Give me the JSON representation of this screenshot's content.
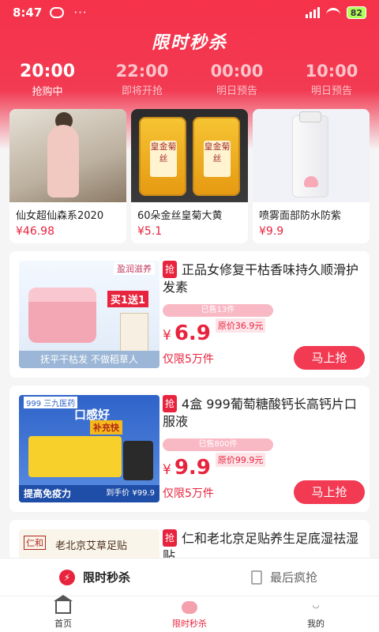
{
  "status_bar": {
    "time": "8:47",
    "dots": "···",
    "battery": "82"
  },
  "page_title": "限时秒杀",
  "time_tabs": [
    {
      "time": "20:00",
      "status": "抢购中",
      "active": true
    },
    {
      "time": "22:00",
      "status": "即将开抢",
      "active": false
    },
    {
      "time": "00:00",
      "status": "明日预告",
      "active": false
    },
    {
      "time": "10:00",
      "status": "明日预告",
      "active": false
    }
  ],
  "featured": [
    {
      "name": "仙女超仙森系2020",
      "price": "¥46.98"
    },
    {
      "name": "60朵金丝皇菊大黄",
      "price": "¥5.1",
      "jar_label": "皇金菊丝"
    },
    {
      "name": "喷雾面部防水防紫",
      "price": "¥9.9"
    }
  ],
  "products": [
    {
      "tag": "抢",
      "title": "正品女修复干枯香味持久顺滑护发素",
      "sold": "已售13件",
      "yen": "¥",
      "price": "6.9",
      "original": "原价36.9元",
      "limit": "仅限5万件",
      "buy": "马上抢",
      "img_top": "盈润滋养",
      "img_red": "买1送1",
      "img_banner": "抚平干枯发  不做稻草人"
    },
    {
      "tag": "抢",
      "title": "4盒 999葡萄糖酸钙长高钙片口服液",
      "sold": "已售800件",
      "yen": "¥",
      "price": "9.9",
      "original": "原价99.9元",
      "limit": "仅限5万件",
      "buy": "马上抢",
      "img_brand": "999 三九医药",
      "img_slogan": "口感好",
      "img_sub": "补充快",
      "img_banner": "提高免疫力",
      "img_price": "到手价 ¥99.9"
    },
    {
      "tag": "抢",
      "title": "仁和老北京足贴养生足底湿祛湿贴",
      "img_logo": "仁和",
      "img_text": "老北京艾草足贴"
    }
  ],
  "bottom_tabs": {
    "left": "限时秒杀",
    "right": "最后疯抢"
  },
  "nav": [
    {
      "label": "首页",
      "icon": "home-icon"
    },
    {
      "label": "限时秒杀",
      "icon": "flash-sale-icon",
      "active": true
    },
    {
      "label": "我的",
      "icon": "profile-icon"
    }
  ],
  "colors": {
    "brand_red": "#e8233d",
    "header_red": "#f5324a"
  }
}
